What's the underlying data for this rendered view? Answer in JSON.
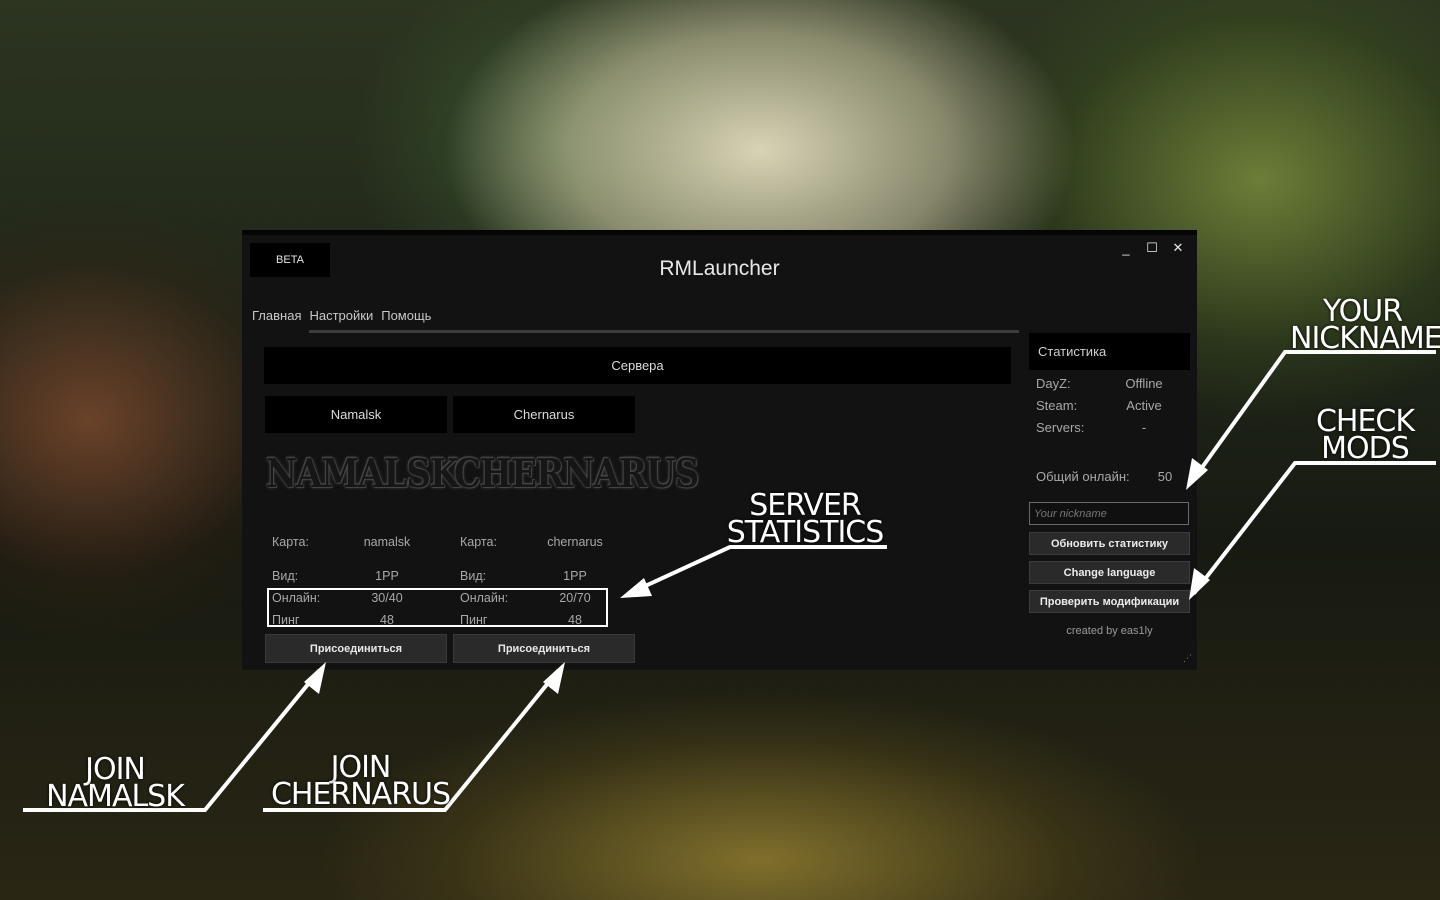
{
  "window": {
    "title": "RMLauncher",
    "badge": "BETA",
    "controls": [
      "_",
      "☐",
      "✕"
    ]
  },
  "tabs": [
    "Главная",
    "Настройки",
    "Помощь"
  ],
  "servers": {
    "header": "Сервера",
    "list": [
      {
        "tab": "Namalsk",
        "logo": "NAMALSK",
        "map_label": "Карта:",
        "map": "namalsk",
        "view_label": "Вид:",
        "view": "1PP",
        "online_label": "Онлайн:",
        "online": "30/40",
        "ping_label": "Пинг",
        "ping": "48",
        "join": "Присоединиться"
      },
      {
        "tab": "Chernarus",
        "logo": "CHERNARUS",
        "map_label": "Карта:",
        "map": "chernarus",
        "view_label": "Вид:",
        "view": "1PP",
        "online_label": "Онлайн:",
        "online": "20/70",
        "ping_label": "Пинг",
        "ping": "48",
        "join": "Присоединиться"
      }
    ]
  },
  "stats": {
    "header": "Статистика",
    "dayz_label": "DayZ:",
    "dayz": "Offline",
    "steam_label": "Steam:",
    "steam": "Active",
    "servers_label": "Servers:",
    "servers": "-",
    "total_label": "Общий онлайн:",
    "total": "50"
  },
  "nickname": {
    "placeholder": "Your nickname"
  },
  "buttons": {
    "refresh": "Обновить статистику",
    "language": "Change language",
    "check_mods": "Проверить модификации"
  },
  "credit": "created by eas1ly",
  "callouts": {
    "your_nickname_1": "YOUR",
    "your_nickname_2": "NICKNAME",
    "check_mods_1": "CHECK",
    "check_mods_2": "MODS",
    "server_stats_1": "SERVER",
    "server_stats_2": "STATISTICS",
    "join_namalsk_1": "JOIN",
    "join_namalsk_2": "NAMALSK",
    "join_chernarus_1": "JOIN",
    "join_chernarus_2": "CHERNARUS"
  }
}
